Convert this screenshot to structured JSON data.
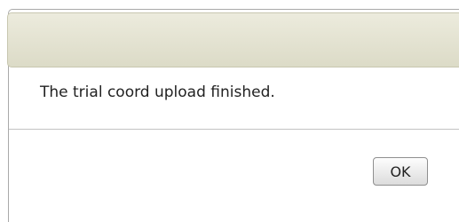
{
  "dialog": {
    "title": "",
    "message": "The trial coord upload finished.",
    "ok_label": "OK"
  },
  "colors": {
    "titlebar": "#e4e3d1",
    "divider": "#c2c2c2",
    "text": "#222222"
  }
}
